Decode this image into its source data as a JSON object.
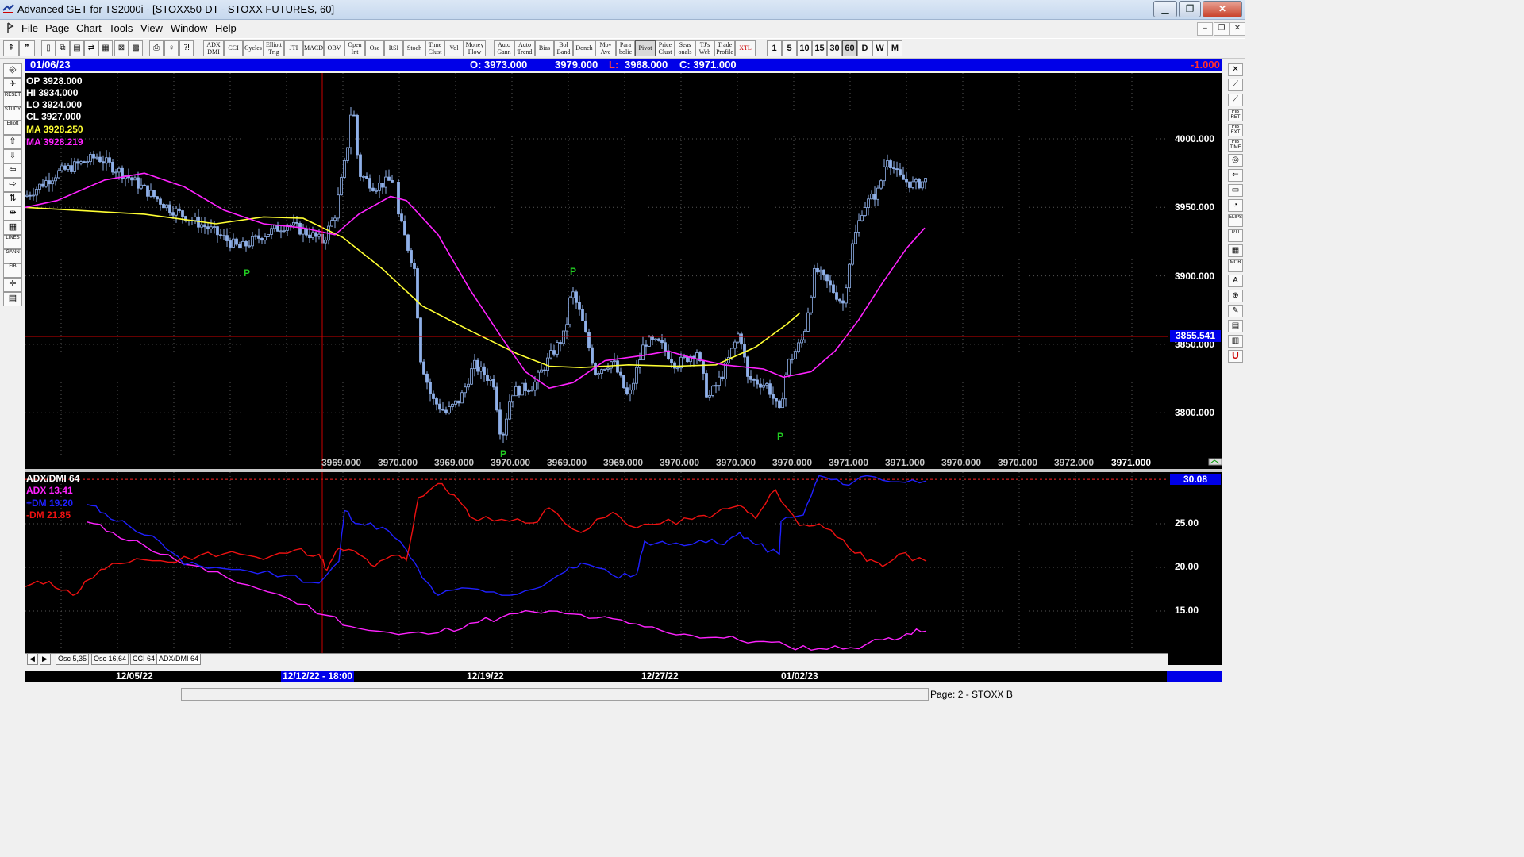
{
  "window": {
    "title": "Advanced GET for TS2000i - [STOXX50-DT - STOXX FUTURES, 60]",
    "minimize": "▁",
    "maximize": "❐",
    "close": "✕"
  },
  "menu": [
    "File",
    "Page",
    "Chart",
    "Tools",
    "View",
    "Window",
    "Help"
  ],
  "mdi_buttons": [
    "–",
    "❐",
    "✕"
  ],
  "toolbar": {
    "indicators": [
      "ADX DMI",
      "CCI",
      "Cycles",
      "Elliott Trig",
      "JTI",
      "MACD",
      "OBV",
      "Open Int",
      "Osc",
      "RSI",
      "Stoch",
      "Time Clust",
      "Vol",
      "Money Flow",
      "Auto Gann",
      "Auto Trend",
      "Bias",
      "Bol Band",
      "Donch",
      "Mov Ave",
      "Para bolic",
      "Pivot",
      "Price Clust",
      "Seas onals",
      "TJ's Web",
      "Trade Profile",
      "XTL"
    ],
    "periods": [
      "1",
      "5",
      "10",
      "15",
      "30",
      "60",
      "D",
      "W",
      "M"
    ],
    "active_period": "60"
  },
  "infobar": {
    "date": "01/06/23",
    "open": "O: 3973.000",
    "high": "3979.000",
    "low_label": "L:",
    "low": "3968.000",
    "close": "C: 3971.000",
    "change": "-1.000"
  },
  "left_tools": [
    "",
    "",
    "RESET",
    "STUDY",
    "Elliott",
    "",
    "",
    "",
    "",
    "",
    "",
    "",
    "LINES",
    "GANN",
    "FIB",
    "",
    ""
  ],
  "right_tools": [
    "",
    "",
    "",
    "FIB RET",
    "FIB EXT",
    "FIB TIME",
    "",
    "",
    "",
    "",
    "ELIPS",
    "PTI",
    "",
    "MOB",
    "",
    "",
    "",
    "",
    "",
    "U"
  ],
  "price_pane": {
    "readout": {
      "op": "OP  3928.000",
      "hi": "HI   3934.000",
      "lo": "LO   3924.000",
      "cl": "CL   3927.000",
      "ma1": "MA  3928.250",
      "ma2": "MA  3928.219"
    },
    "axis_labels": [
      "4000.000",
      "3950.000",
      "3900.000",
      "3850.000",
      "3800.000"
    ],
    "cursor_price": "3855.541",
    "cycle_values": [
      "3969.000",
      "3970.000",
      "3969.000",
      "3970.000",
      "3969.000",
      "3969.000",
      "3970.000",
      "3970.000",
      "3970.000",
      "3971.000",
      "3971.000",
      "3970.000",
      "3970.000",
      "3972.000",
      "3971.000"
    ],
    "pivot_label": "P",
    "colors": {
      "ma_slow": "#ffff33",
      "ma_fast": "#ff22ff",
      "candles": "#8fb0e8",
      "pivot": "#22cc22",
      "cursor": "#cc0000"
    }
  },
  "osc_pane": {
    "title": "ADX/DMI 64",
    "adx": "ADX 13.41",
    "dm_plus": "+DM 19.20",
    "dm_minus": "-DM  21.85",
    "axis_labels": [
      "25.00",
      "20.00",
      "15.00"
    ],
    "threshold": "30.08",
    "colors": {
      "adx": "#ff22ff",
      "dm_plus": "#2020ff",
      "dm_minus": "#ee1111",
      "threshold": "#ff2222"
    }
  },
  "tabs": [
    "Osc 5,35",
    "Osc 16,64",
    "CCI 64",
    "ADX/DMI 64"
  ],
  "active_tab": "ADX/DMI 64",
  "dates": [
    "12/05/22",
    "12/12/22 - 18:00",
    "12/19/22",
    "12/27/22",
    "01/02/23"
  ],
  "status": {
    "page": "Page: 2 - STOXX B"
  }
}
